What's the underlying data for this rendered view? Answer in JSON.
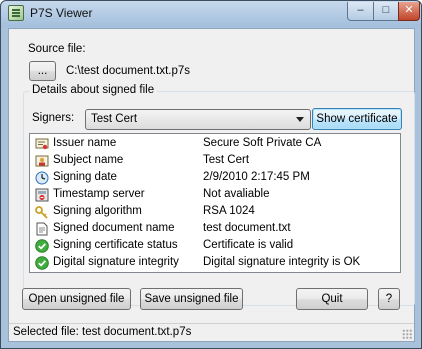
{
  "window": {
    "title": "P7S Viewer",
    "minimize": "–",
    "maximize": "□",
    "close": "✕"
  },
  "source": {
    "label": "Source file:",
    "browse_label": "...",
    "path": "C:\\test document.txt.p7s"
  },
  "details": {
    "group_title": "Details about signed file",
    "signers_label": "Signers:",
    "selected_signer": "Test Cert",
    "show_certificate_label": "Show certificate",
    "rows": [
      {
        "icon": "certificate-icon",
        "name": "Issuer name",
        "value": "Secure Soft Private CA"
      },
      {
        "icon": "person-icon",
        "name": "Subject name",
        "value": "Test Cert"
      },
      {
        "icon": "clock-icon",
        "name": "Signing date",
        "value": "2/9/2010 2:17:45 PM"
      },
      {
        "icon": "server-icon",
        "name": "Timestamp server",
        "value": "Not avaliable"
      },
      {
        "icon": "key-icon",
        "name": "Signing algorithm",
        "value": "RSA 1024"
      },
      {
        "icon": "document-icon",
        "name": "Signed document name",
        "value": "test document.txt"
      },
      {
        "icon": "check-icon",
        "name": "Signing certificate status",
        "value": "Certificate is valid"
      },
      {
        "icon": "check-icon",
        "name": "Digital signature integrity",
        "value": "Digital signature integrity is OK"
      }
    ]
  },
  "buttons": {
    "open_unsigned": "Open unsigned file",
    "save_unsigned": "Save unsigned file",
    "quit": "Quit",
    "help": "?"
  },
  "status": {
    "text": "Selected file: test document.txt.p7s"
  },
  "colors": {
    "check": "#3fae3f",
    "window_frame": "#a9c2dc"
  }
}
